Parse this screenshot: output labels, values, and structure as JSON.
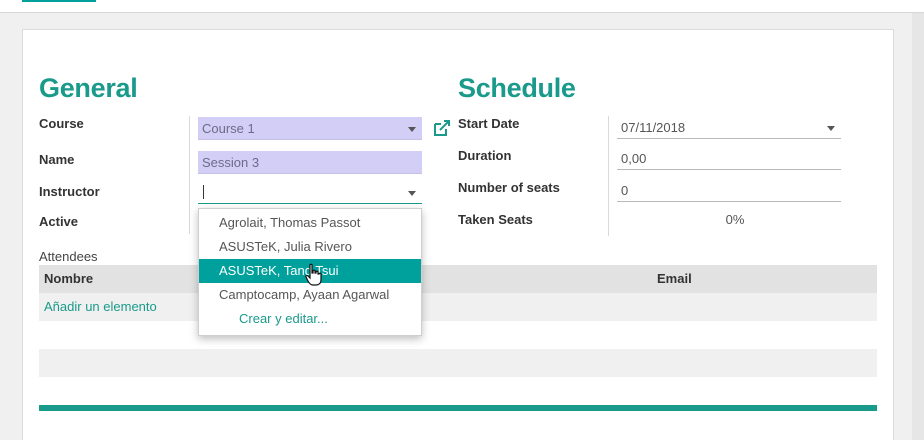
{
  "general": {
    "title": "General",
    "course_label": "Course",
    "course_value": "Course 1",
    "name_label": "Name",
    "name_value": "Session 3",
    "instructor_label": "Instructor",
    "instructor_value": "",
    "active_label": "Active"
  },
  "schedule": {
    "title": "Schedule",
    "start_date_label": "Start Date",
    "start_date_value": "07/11/2018",
    "duration_label": "Duration",
    "duration_value": "0,00",
    "seats_label": "Number of seats",
    "seats_value": "0",
    "taken_label": "Taken Seats",
    "taken_value": "0%"
  },
  "attendees": {
    "label": "Attendees",
    "columns": [
      "Nombre",
      "Email"
    ],
    "add_link": "Añadir un elemento"
  },
  "dropdown": {
    "options": [
      "Agrolait, Thomas Passot",
      "ASUSTeK, Julia Rivero",
      "ASUSTeK, Tang Tsui",
      "Camptocamp, Ayaan Agarwal"
    ],
    "highlighted_index": 2,
    "create_edit": "Crear y editar..."
  },
  "colors": {
    "accent": "#00a09d",
    "title": "#1a9a8a",
    "required_bg": "#d2cef5"
  }
}
